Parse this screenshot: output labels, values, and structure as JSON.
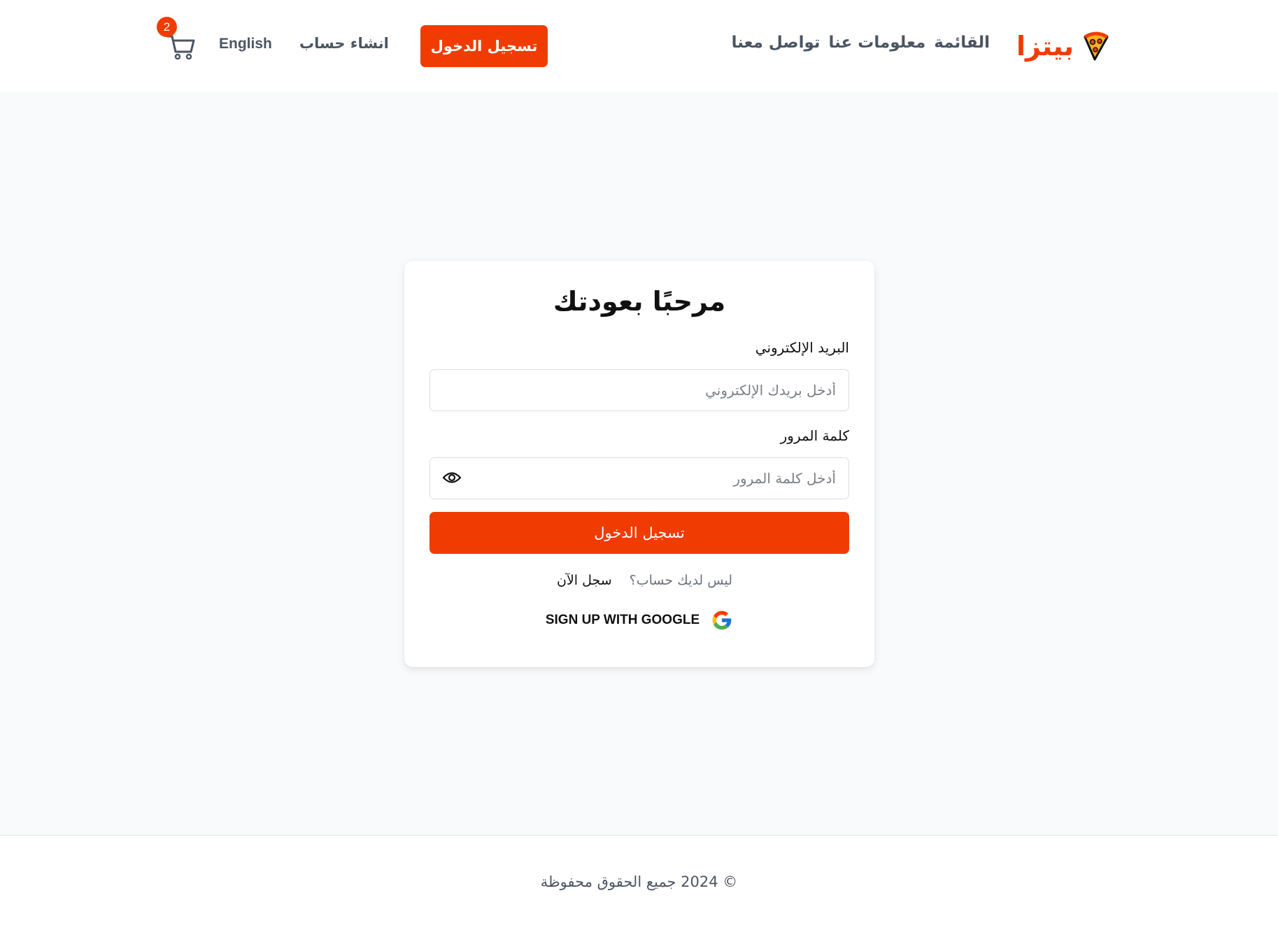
{
  "header": {
    "brand_name": "بيتزا",
    "nav": {
      "menu": "القائمة",
      "about": "معلومات عنا",
      "contact": "تواصل معنا"
    },
    "login_label": "تسجيل الدخول",
    "signup_label": "انشاء حساب",
    "language_label": "English",
    "cart_count": "2"
  },
  "login_card": {
    "title": "مرحبًا بعودتك",
    "email_label": "البريد الإلكتروني",
    "email_placeholder": "أدخل بريدك الإلكتروني",
    "password_label": "كلمة المرور",
    "password_placeholder": "أدخل كلمة المرور",
    "submit_label": "تسجيل الدخول",
    "no_account_text": "ليس لديك حساب؟",
    "register_now_label": "سجل الآن",
    "google_label": "SIGN UP WITH GOOGLE"
  },
  "footer": {
    "copyright": "© 2024 جميع الحقوق محفوظة"
  },
  "colors": {
    "accent": "#f03c02",
    "nav_text": "#4b5563",
    "page_bg": "#f9fafb"
  },
  "icons": {
    "logo": "pizza-slice-icon",
    "cart": "shopping-cart-icon",
    "password_toggle": "eye-icon",
    "google": "google-icon"
  }
}
